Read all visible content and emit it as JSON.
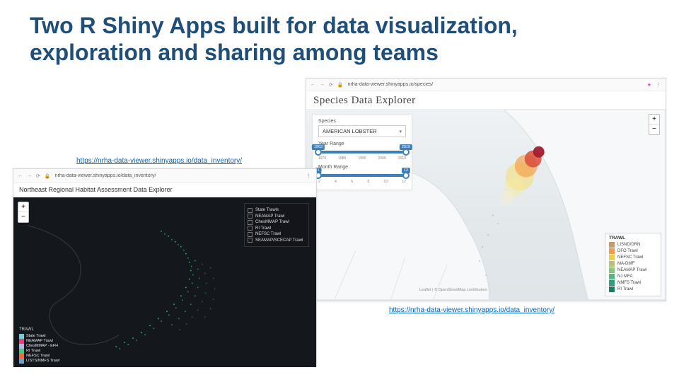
{
  "title": "Two R Shiny Apps built for data visualization, exploration and sharing among teams",
  "links": {
    "left": "https://nrha-data-viewer.shinyapps.io/data_inventory/",
    "right": "https://nrha-data-viewer.shinyapps.io/data_inventory/"
  },
  "app1": {
    "chrome": {
      "nav_back": "←",
      "nav_fwd": "→",
      "reload": "⟳",
      "lock": "🔒",
      "url": "nrha-data-viewer.shinyapps.io/data_inventory/",
      "menu": "⋮"
    },
    "header": "Northeast Regional Habitat Assessment Data Explorer",
    "zoom_in": "+",
    "zoom_out": "−",
    "checklist": [
      "State Trawls",
      "NEAMAP Trawl",
      "ChesMMAP Trawl",
      "RI Trawl",
      "NEFSC Trawl",
      "SEAMAP/SCECAP Trawl"
    ],
    "legend_title": "TRAWL",
    "legend_items": [
      {
        "label": "State Trawl",
        "color": "#6fd0d6"
      },
      {
        "label": "NEAMAP Trawl",
        "color": "#ef3b7a"
      },
      {
        "label": "ChesMMAP - EFH",
        "color": "#b6b4e6"
      },
      {
        "label": "RI Trawl",
        "color": "#33d07e"
      },
      {
        "label": "NEFSC Trawl",
        "color": "#f06a3c"
      },
      {
        "label": "LISTS/NMFS Trawl",
        "color": "#66a0d8"
      }
    ]
  },
  "app2": {
    "chrome": {
      "nav_back": "←",
      "nav_fwd": "→",
      "reload": "⟳",
      "lock": "🔒",
      "url": "nrha-data-viewer.shinyapps.io/species/",
      "star": "★",
      "menu": "⋮"
    },
    "header": "Species Data Explorer",
    "panel": {
      "species_label": "Species",
      "species_value": "AMERICAN LOBSTER",
      "caret": "▾",
      "year_label": "Year Range",
      "year_min": "1963",
      "year_max": "2019",
      "year_ticks": [
        "1970",
        "1980",
        "1990",
        "2000",
        "2010"
      ],
      "month_label": "Month Range",
      "month_min": "1",
      "month_max": "12",
      "month_ticks": [
        "2",
        "4",
        "6",
        "8",
        "10",
        "12"
      ]
    },
    "zoom_in": "+",
    "zoom_out": "−",
    "legend_title": "TRAWL",
    "legend_items": [
      {
        "label": "LISND/DRN",
        "color": "#c49a6c"
      },
      {
        "label": "DFO Trawl",
        "color": "#f29d49"
      },
      {
        "label": "NEFSC Trawl",
        "color": "#e9ce52"
      },
      {
        "label": "MA-DMF",
        "color": "#bac07c"
      },
      {
        "label": "NEAMAP Trawl",
        "color": "#89c97e"
      },
      {
        "label": "NJ MFA",
        "color": "#56b881"
      },
      {
        "label": "NMFS Trawl",
        "color": "#2f9e78"
      },
      {
        "label": "RI Trawl",
        "color": "#1f7a63"
      }
    ],
    "attribution": "Leaflet | © OpenStreetMap contributors"
  }
}
